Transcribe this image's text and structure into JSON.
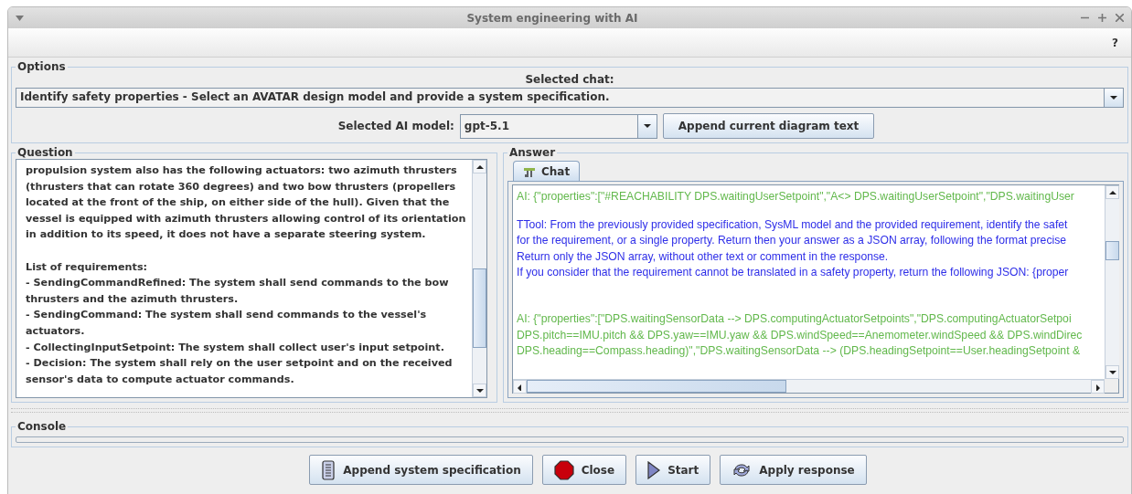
{
  "window": {
    "title": "System engineering with AI"
  },
  "menu_bar": {
    "help": "?"
  },
  "options": {
    "title": "Options",
    "chat_label": "Selected chat:",
    "chat_value": "Identify safety properties - Select an AVATAR design model and provide a system specification.",
    "model_label": "Selected AI model:",
    "model_value": "gpt-5.1",
    "append_button": "Append current diagram text"
  },
  "question": {
    "title": "Question",
    "text": "propulsion system also has the following actuators: two azimuth thrusters\n(thrusters that can rotate 360 degrees) and two bow thrusters (propellers\nlocated at the front of the ship, on either side of the hull). Given that the\nvessel is equipped with azimuth thrusters allowing control of its orientation\nin addition to its speed, it does not have a separate steering system.\n\nList of requirements:\n- SendingCommandRefined: The system shall send commands to the bow\nthrusters and the azimuth thrusters.\n- SendingCommand: The system shall send commands to the vessel's\nactuators.\n- CollectingInputSetpoint: The system shall collect user's input setpoint.\n- Decision: The system shall rely on the user setpoint and on the received\nsensor's data to compute actuator commands."
  },
  "answer": {
    "title": "Answer",
    "tabs": [
      {
        "label": "Chat",
        "selected": true
      }
    ],
    "messages": [
      {
        "kind": "ai",
        "text": "AI: {\"properties\":[\"#REACHABILITY DPS.waitingUserSetpoint\",\"A<> DPS.waitingUserSetpoint\",\"DPS.waitingUser"
      },
      {
        "kind": "tool",
        "text": "TTool: From the previously provided specification, SysML model and the provided requirement, identify the safet\nfor the requirement, or a single property. Return then your answer as a JSON array, following the format precise\nReturn only the JSON array, without other text or comment in the response.\nIf you consider that the requirement cannot be translated in a safety property, return the following JSON: {proper"
      },
      {
        "kind": "ai",
        "text": "AI: {\"properties\":[\"DPS.waitingSensorData --> DPS.computingActuatorSetpoints\",\"DPS.computingActuatorSetpoi\nDPS.pitch==IMU.pitch && DPS.yaw==IMU.yaw && DPS.windSpeed==Anemometer.windSpeed && DPS.windDirec\nDPS.heading==Compass.heading)\",\"DPS.waitingSensorData --> (DPS.headingSetpoint==User.headingSetpoint &"
      }
    ]
  },
  "console": {
    "title": "Console"
  },
  "buttons": [
    {
      "label": "Append system specification",
      "kind": "scroll"
    },
    {
      "label": "Close",
      "kind": "stop"
    },
    {
      "label": "Start",
      "kind": "play"
    },
    {
      "label": "Apply response",
      "kind": "refresh"
    }
  ]
}
